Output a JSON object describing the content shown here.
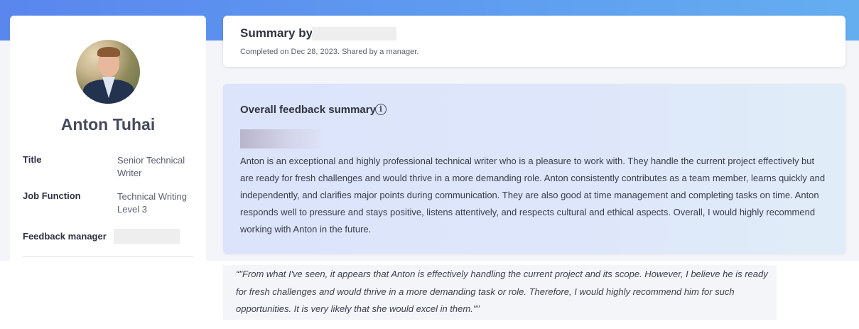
{
  "profile": {
    "name": "Anton Tuhai",
    "fields": [
      {
        "label": "Title",
        "value": "Senior Technical Writer"
      },
      {
        "label": "Job Function",
        "value": "Technical Writing Level 3"
      },
      {
        "label": "Feedback manager",
        "value": ""
      }
    ]
  },
  "summary": {
    "title": "Summary by",
    "subtitle": "Completed on Dec 28, 2023. Shared by a manager."
  },
  "overall": {
    "heading": "Overall feedback summary",
    "info_icon": "info-circle-icon",
    "body": "Anton is an exceptional and highly professional technical writer who is a pleasure to work with. They handle the current project effectively but are ready for fresh challenges and would thrive in a more demanding role. Anton consistently contributes as a team member, learns quickly and independently, and clarifies major points during communication. They are also good at time management and completing tasks on time. Anton responds well to pressure and stays positive, listens attentively, and respects cultural and ethical aspects. Overall, I would highly recommend working with Anton in the future."
  },
  "quote": {
    "text": "“\"From what I've seen, it appears that Anton is effectively handling the current project and its scope. However, I believe he is ready for fresh challenges and would thrive in a more demanding task or role. Therefore, I would highly recommend him for such opportunities. It is very likely that she would excel in them.\"”"
  },
  "colors": {
    "header_gradient_start": "#5a86ee",
    "header_gradient_end": "#64aef0",
    "feedback_card_bg": "#dce4fb",
    "page_bg": "#f4f5f9"
  }
}
